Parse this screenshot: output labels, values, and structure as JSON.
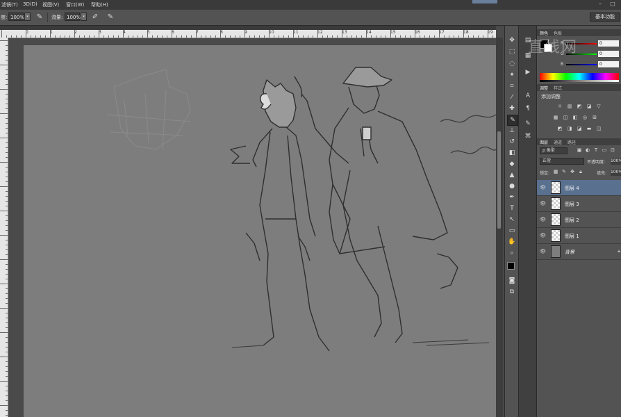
{
  "menubar": {
    "items": [
      "滤镜(T)",
      "3D(D)",
      "视图(V)",
      "窗口(W)",
      "帮助(H)"
    ],
    "minimize_label": "–",
    "restore_label": "□"
  },
  "options_bar": {
    "opacity_label": "度:",
    "opacity_value": "100%",
    "flow_label": "流量:",
    "flow_value": "100%",
    "workspace_label": "基本功能"
  },
  "rulers": {
    "h_numbers": [
      "0",
      "1",
      "2",
      "3",
      "4",
      "5",
      "6",
      "7",
      "8",
      "9",
      "10",
      "11",
      "12",
      "13",
      "14",
      "15",
      "16",
      "17",
      "18",
      "19"
    ]
  },
  "panels": {
    "color_tabs": [
      "颜色",
      "色板"
    ],
    "color_sliders": [
      {
        "letter": "R",
        "value": "0"
      },
      {
        "letter": "G",
        "value": "0"
      },
      {
        "letter": "B",
        "value": "0"
      }
    ],
    "adjust_tabs": [
      "调整",
      "样式"
    ],
    "adjust_title": "添加调整",
    "layers_tabs": [
      "图层",
      "通道",
      "路径"
    ],
    "filter_kind": "ρ 类型",
    "blend_mode": "正常",
    "opacity_label": "不透明度:",
    "opacity_value": "100%",
    "lock_label": "锁定:",
    "fill_label": "填充:",
    "fill_value": "100%",
    "layers": [
      {
        "name": "图层 4",
        "selected": true
      },
      {
        "name": "图层 3",
        "selected": false
      },
      {
        "name": "图层 2",
        "selected": false
      },
      {
        "name": "图层 1",
        "selected": false
      },
      {
        "name": "背景",
        "selected": false,
        "background": true
      }
    ]
  },
  "watermark": "直线网",
  "colors": {
    "accent_selected_layer": "#59708f",
    "canvas": "#7d7d7d",
    "ui_panel": "#535353"
  }
}
